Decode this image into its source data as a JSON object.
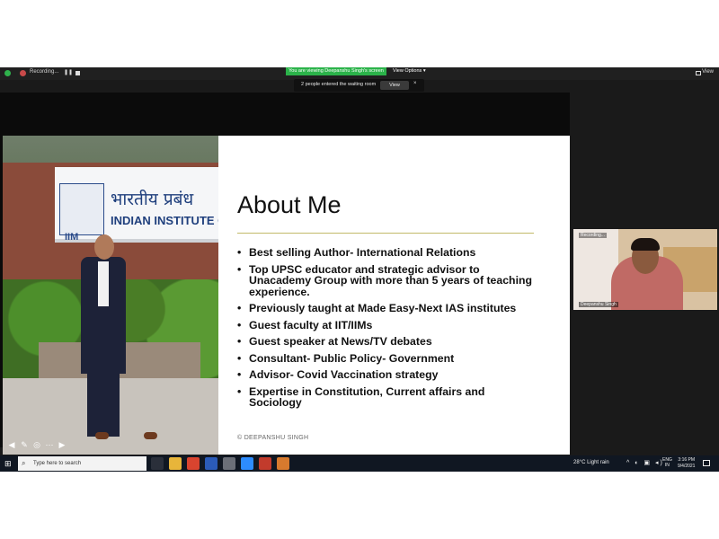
{
  "zoom": {
    "recording_label": "Recording...",
    "viewing_banner": "You are viewing Deepanshu Singh's screen",
    "view_options_label": "View Options ▾",
    "view_label": "View",
    "waiting_room": {
      "text": "2 people entered the waiting room",
      "button": "View",
      "close": "×"
    }
  },
  "slide": {
    "title": "About Me",
    "bullets": [
      "Best selling Author- International Relations",
      "Top UPSC educator and strategic advisor to Unacademy Group with more than 5 years of teaching experience.",
      "Previously taught at Made Easy-Next IAS institutes",
      "Guest faculty at IIT/IIMs",
      "Guest speaker at News/TV debates",
      "Consultant- Public Policy- Government",
      "Advisor- Covid Vaccination strategy",
      "Expertise in Constitution, Current affairs and Sociology"
    ],
    "copyright": "© DEEPANSHU SINGH",
    "photo_sign": {
      "hindi": "भारतीय प्रबंध",
      "english": "INDIAN INSTITUTE OF",
      "logo_text": "IIM"
    },
    "tool_icons": [
      "arrow-left-icon",
      "pen-icon",
      "zoom-icon",
      "more-icon",
      "arrow-right-icon"
    ]
  },
  "participant": {
    "top_label": "Recording...",
    "name": "Deepanshu Singh"
  },
  "taskbar": {
    "search_placeholder": "Type here to search",
    "weather": "28°C  Light rain",
    "lang_line1": "ENG",
    "lang_line2": "IN",
    "time": "3:16 PM",
    "date": "9/4/2021",
    "icons": [
      {
        "name": "task-view-icon",
        "color": "#2a2f3a"
      },
      {
        "name": "file-explorer-icon",
        "color": "#e8b53a"
      },
      {
        "name": "chrome-icon",
        "color": "#d9442f"
      },
      {
        "name": "word-icon",
        "color": "#2b5bb8"
      },
      {
        "name": "app-icon",
        "color": "#6b6f78"
      },
      {
        "name": "zoom-icon",
        "color": "#2d8cff"
      },
      {
        "name": "chrome-profile-icon",
        "color": "#c23b2c"
      },
      {
        "name": "store-icon",
        "color": "#d77a2e"
      }
    ]
  }
}
